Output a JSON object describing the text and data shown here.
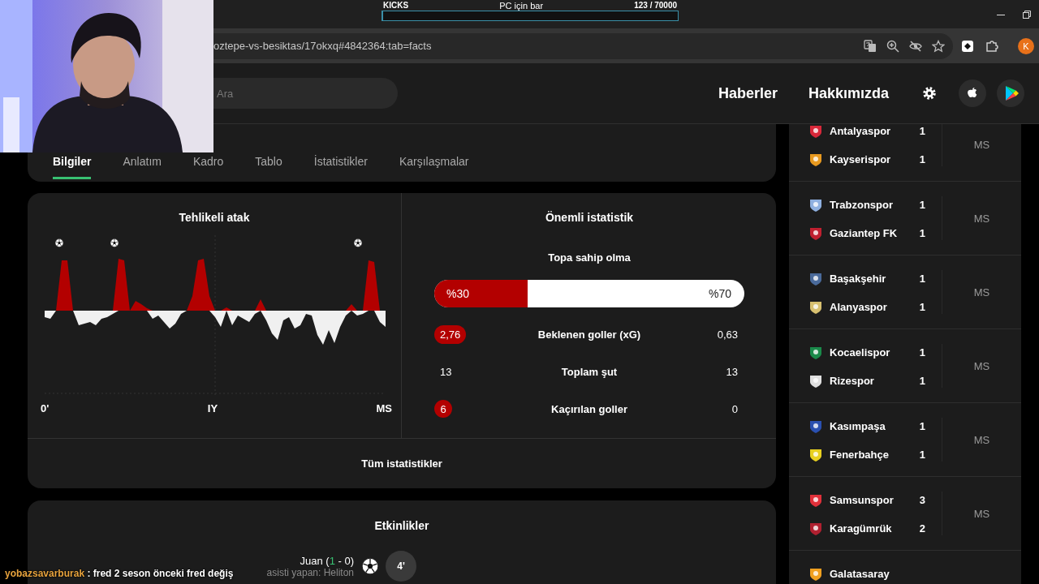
{
  "stream_goal": {
    "label": "KICKS",
    "title": "PC için bar",
    "count": "123  / 70000",
    "level": 0.002
  },
  "browser": {
    "url": "oztepe-vs-besiktas/17okxq#4842364:tab=facts",
    "profile_initial": "K"
  },
  "header": {
    "search_placeholder": "Ara",
    "nav": [
      "Haberler",
      "Hakkımızda"
    ]
  },
  "tabs": [
    {
      "label": "Bilgiler",
      "selected": true
    },
    {
      "label": "Anlatım",
      "selected": false
    },
    {
      "label": "Kadro",
      "selected": false
    },
    {
      "label": "Tablo",
      "selected": false
    },
    {
      "label": "İstatistikler",
      "selected": false
    },
    {
      "label": "Karşılaşmalar",
      "selected": false
    }
  ],
  "attack_chart": {
    "title": "Tehlikeli atak",
    "axis_labels": [
      "0'",
      "IY",
      "MS"
    ]
  },
  "key_stats": {
    "title": "Önemli istatistik",
    "possession": {
      "label": "Topa sahip olma",
      "home": "%30",
      "away": "%70",
      "level": 0.3
    },
    "rows": [
      {
        "home": "2,76",
        "label": "Beklenen goller (xG)",
        "away": "0,63",
        "highlighted": true
      },
      {
        "home": "13",
        "label": "Toplam şut",
        "away": "13",
        "highlighted": false
      },
      {
        "home": "6",
        "label": "Kaçırılan goller",
        "away": "0",
        "highlighted": true
      }
    ],
    "link": "Tüm istatistikler"
  },
  "events": {
    "title": "Etkinlikler",
    "items": [
      {
        "kind": "goal",
        "parts": [
          {
            "text": "Juan (",
            "kind": "plain"
          },
          {
            "text": "1",
            "kind": "scored"
          },
          {
            "text": " - 0)",
            "kind": "plain"
          }
        ],
        "assist": "asisti yapan: Heliton",
        "minute": "4'"
      }
    ]
  },
  "matches": [
    {
      "status": "MS",
      "teams": [
        {
          "name": "Antalyaspor",
          "score": "1",
          "color": "#d8283a"
        },
        {
          "name": "Kayserispor",
          "score": "1",
          "color": "#e89a20"
        }
      ]
    },
    {
      "status": "MS",
      "teams": [
        {
          "name": "Trabzonspor",
          "score": "1",
          "color": "#8fb0e0"
        },
        {
          "name": "Gaziantep FK",
          "score": "1",
          "color": "#c02030"
        }
      ]
    },
    {
      "status": "MS",
      "teams": [
        {
          "name": "Başakşehir",
          "score": "1",
          "color": "#4a6a9a"
        },
        {
          "name": "Alanyaspor",
          "score": "1",
          "color": "#d8c070"
        }
      ]
    },
    {
      "status": "MS",
      "teams": [
        {
          "name": "Kocaelispor",
          "score": "1",
          "color": "#1a8a4a"
        },
        {
          "name": "Rizespor",
          "score": "1",
          "color": "#e0e0e0"
        }
      ]
    },
    {
      "status": "MS",
      "teams": [
        {
          "name": "Kasımpaşa",
          "score": "1",
          "color": "#2a50b0"
        },
        {
          "name": "Fenerbahçe",
          "score": "1",
          "color": "#e8d020"
        }
      ]
    },
    {
      "status": "MS",
      "teams": [
        {
          "name": "Samsunspor",
          "score": "3",
          "color": "#e0303a"
        },
        {
          "name": "Karagümrük",
          "score": "2",
          "color": "#b02030"
        }
      ]
    },
    {
      "teams": [
        {
          "name": "Galatasaray",
          "color": "#f0a020"
        }
      ]
    }
  ],
  "chat": {
    "user": "yobazsavarburak",
    "message": ": fred 2 seson önceki fred değiş"
  }
}
